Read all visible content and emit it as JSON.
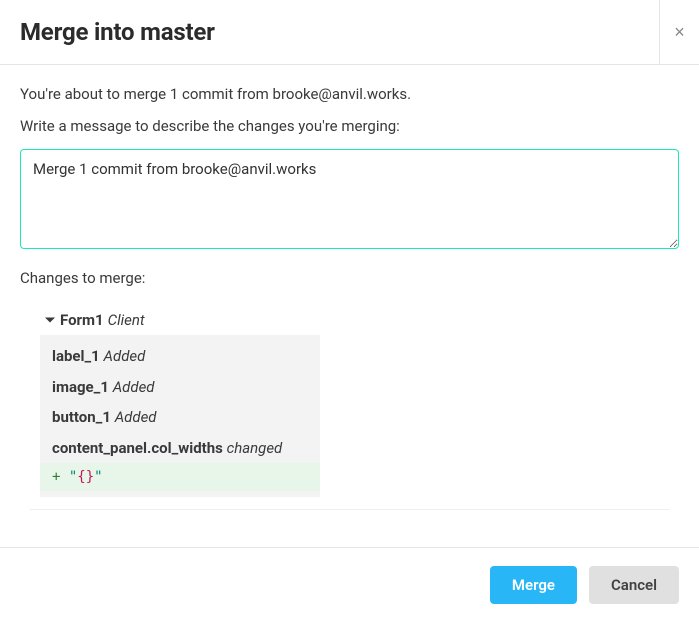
{
  "header": {
    "title": "Merge into master",
    "close_label": "×"
  },
  "body": {
    "intro": "You're about to merge 1 commit from brooke@anvil.works.",
    "message_prompt": "Write a message to describe the changes you're merging:",
    "message_value": "Merge 1 commit from brooke@anvil.works",
    "changes_label": "Changes to merge:"
  },
  "changes": {
    "form": {
      "name": "Form1",
      "type": "Client"
    },
    "items": [
      {
        "name": "label_1",
        "status": "Added"
      },
      {
        "name": "image_1",
        "status": "Added"
      },
      {
        "name": "button_1",
        "status": "Added"
      },
      {
        "name": "content_panel.col_widths",
        "status": "changed"
      }
    ],
    "diff": {
      "prefix": "+ ",
      "quote_open": "\"",
      "brace_open": "{",
      "brace_close": "}",
      "quote_close": "\""
    }
  },
  "footer": {
    "merge_label": "Merge",
    "cancel_label": "Cancel"
  }
}
